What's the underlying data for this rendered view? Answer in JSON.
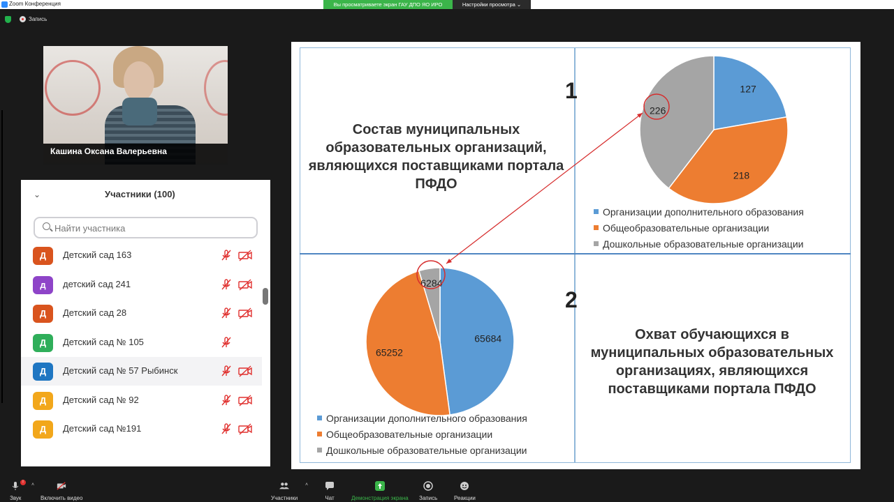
{
  "window": {
    "title": "Zoom Конференция",
    "share_banner": "Вы просматриваете экран ГАУ ДПО ЯО ИРО",
    "view_options": "Настройки просмотра ⌄",
    "recording_label": "Запись"
  },
  "video": {
    "speaker_name": "Кашина Оксана Валерьевна"
  },
  "participants": {
    "title": "Участники (100)",
    "search_placeholder": "Найти участника",
    "items": [
      {
        "initial": "Д",
        "name": "Детский сад 163",
        "color": "#d9541e",
        "mic_muted": true,
        "cam_off": true
      },
      {
        "initial": "д",
        "name": "детский сад 241",
        "color": "#8e44c8",
        "mic_muted": true,
        "cam_off": true
      },
      {
        "initial": "Д",
        "name": "Детский сад 28",
        "color": "#d9541e",
        "mic_muted": true,
        "cam_off": true
      },
      {
        "initial": "Д",
        "name": "Детский сад № 105",
        "color": "#2fae5a",
        "mic_muted": true,
        "cam_off": false
      },
      {
        "initial": "Д",
        "name": "Детский сад № 57 Рыбинск",
        "color": "#1f76c2",
        "mic_muted": true,
        "cam_off": true
      },
      {
        "initial": "Д",
        "name": "Детский сад № 92",
        "color": "#f2a71b",
        "mic_muted": true,
        "cam_off": true
      },
      {
        "initial": "Д",
        "name": "Детский сад №191",
        "color": "#f2a71b",
        "mic_muted": true,
        "cam_off": true
      }
    ]
  },
  "slide": {
    "section1": {
      "number": "1",
      "title": "Состав муниципальных образовательных организаций, являющихся поставщиками портала ПФДО"
    },
    "section2": {
      "number": "2",
      "title": "Охват обучающихся в муниципальных образовательных организациях, являющихся поставщиками портала ПФДО"
    }
  },
  "chart_data": [
    {
      "type": "pie",
      "title": "Состав муниципальных образовательных организаций, являющихся поставщиками портала ПФДО",
      "categories": [
        "Организации дополнительного образования",
        "Общеобразовательные организации",
        "Дошкольные образовательные организации"
      ],
      "values": [
        127,
        218,
        226
      ],
      "colors": [
        "#5b9bd5",
        "#ed7d31",
        "#a5a5a5"
      ],
      "legend": "bottom"
    },
    {
      "type": "pie",
      "title": "Охват обучающихся в муниципальных образовательных организациях, являющихся поставщиками портала ПФДО",
      "categories": [
        "Организации дополнительного образования",
        "Общеобразовательные организации",
        "Дошкольные образовательные организации"
      ],
      "values": [
        65684,
        65252,
        6284
      ],
      "colors": [
        "#5b9bd5",
        "#ed7d31",
        "#a5a5a5"
      ],
      "legend": "bottom"
    }
  ],
  "toolbar": {
    "audio": "Звук",
    "audio_badge": "!",
    "video": "Включить видео",
    "participants": "Участники",
    "chat": "Чат",
    "share": "Демонстрация экрана",
    "record": "Запись",
    "reactions": "Реакции"
  }
}
